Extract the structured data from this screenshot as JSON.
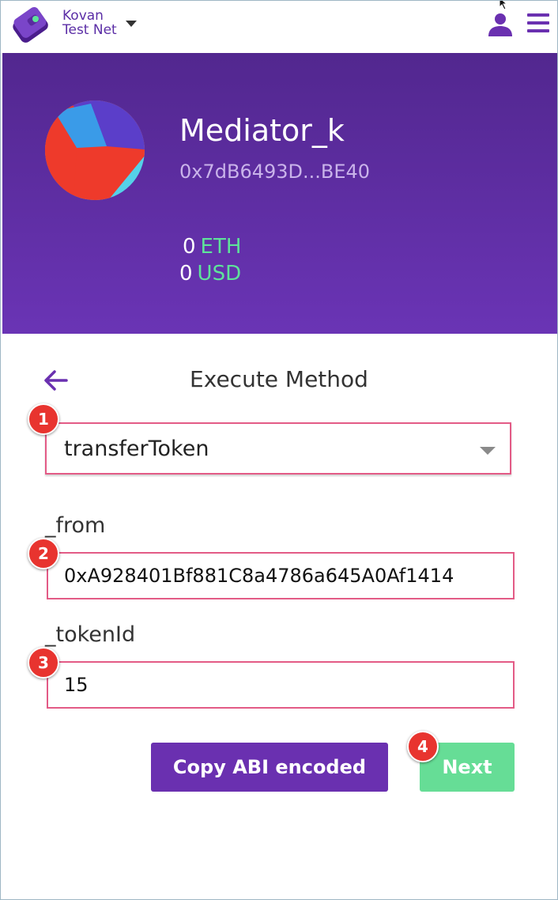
{
  "topbar": {
    "network_line1": "Kovan",
    "network_line2": "Test Net",
    "brand_color": "#6a30b0"
  },
  "contract": {
    "name": "Mediator_k",
    "address": "0x7dB6493D...BE40",
    "balances": [
      {
        "amount": "0",
        "unit": "ETH"
      },
      {
        "amount": "0",
        "unit": "USD"
      }
    ],
    "unit_color": "#5ee39a"
  },
  "page": {
    "title": "Execute Method"
  },
  "method_select": {
    "value": "transferToken"
  },
  "fields": [
    {
      "label": "_from",
      "value": "0xA928401Bf881C8a4786a645A0Af1414"
    },
    {
      "label": "_tokenId",
      "value": "15"
    }
  ],
  "badges": [
    "1",
    "2",
    "3",
    "4"
  ],
  "buttons": {
    "copy_label": "Copy ABI encoded",
    "next_label": "Next"
  }
}
